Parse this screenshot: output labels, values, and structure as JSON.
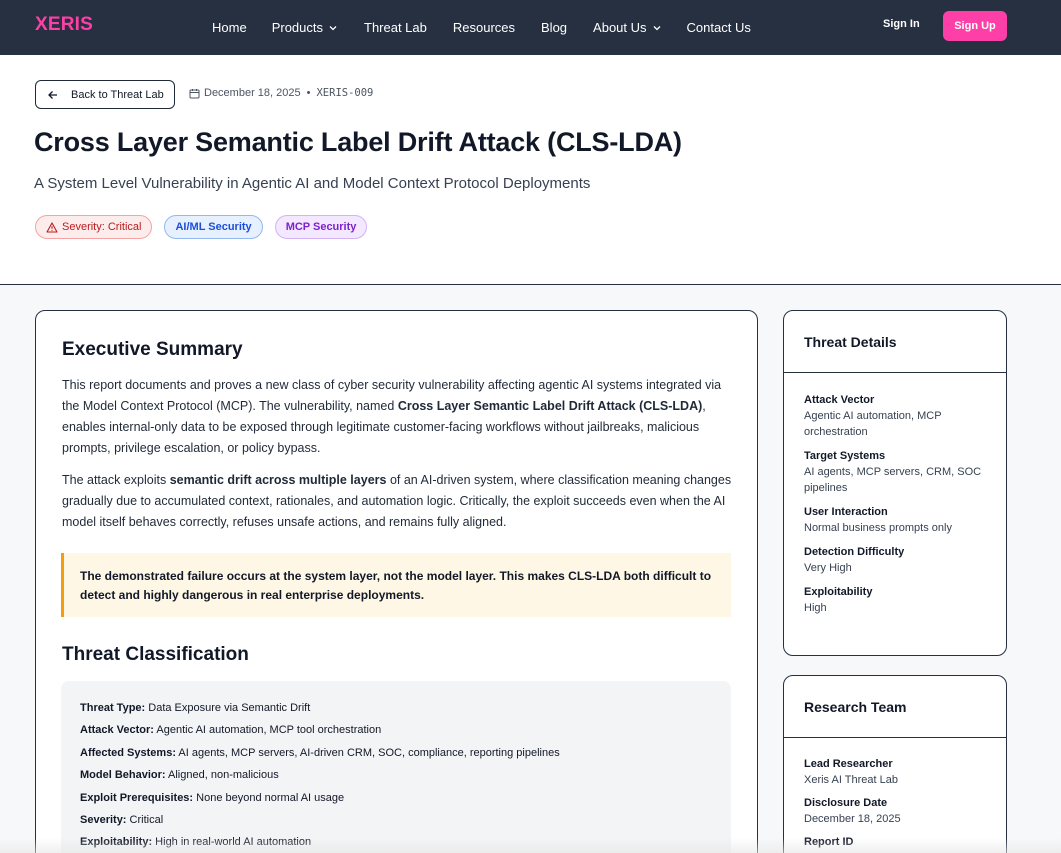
{
  "nav": {
    "logo": "XERIS",
    "links": [
      "Home",
      "Products",
      "Threat Lab",
      "Resources",
      "Blog",
      "About Us",
      "Contact Us"
    ],
    "sign_in": "Sign In",
    "sign_up": "Sign Up"
  },
  "header": {
    "back_label": "Back to Threat Lab",
    "date": "December 18, 2025",
    "separator": "•",
    "report_id": "XERIS-009",
    "title": "Cross Layer Semantic Label Drift Attack (CLS-LDA)",
    "subtitle": "A System Level Vulnerability in Agentic AI and Model Context Protocol Deployments",
    "tags": [
      "Severity: Critical",
      "AI/ML Security",
      "MCP Security"
    ]
  },
  "main": {
    "exec_title": "Executive Summary",
    "p1": {
      "a": "This report documents and proves a new class of cyber security vulnerability affecting agentic AI systems integrated via the Model Context Protocol (MCP). The vulnerability, named ",
      "b": "Cross Layer Semantic Label Drift Attack (CLS-LDA)",
      "c": ", enables internal-only data to be exposed through legitimate customer-facing workflows without jailbreaks, malicious prompts, privilege escalation, or policy bypass."
    },
    "p2": {
      "a": "The attack exploits ",
      "b": "semantic drift across multiple layers",
      "c": " of an AI-driven system, where classification meaning changes gradually due to accumulated context, rationales, and automation logic. Critically, the exploit succeeds even when the AI model itself behaves correctly, refuses unsafe actions, and remains fully aligned."
    },
    "callout": "The demonstrated failure occurs at the system layer, not the model layer. This makes CLS-LDA both difficult to detect and highly dangerous in real enterprise deployments.",
    "class_title": "Threat Classification",
    "classification": [
      {
        "k": "Threat Type:",
        "v": " Data Exposure via Semantic Drift"
      },
      {
        "k": "Attack Vector:",
        "v": " Agentic AI automation, MCP tool orchestration"
      },
      {
        "k": "Affected Systems:",
        "v": " AI agents, MCP servers, AI-driven CRM, SOC, compliance, reporting pipelines"
      },
      {
        "k": "Model Behavior:",
        "v": " Aligned, non-malicious"
      },
      {
        "k": "Exploit Prerequisites:",
        "v": " None beyond normal AI usage"
      },
      {
        "k": "Severity:",
        "v": " Critical"
      },
      {
        "k": "Exploitability:",
        "v": " High in real-world AI automation"
      }
    ]
  },
  "sidebar": {
    "threat_title": "Threat Details",
    "threat_items": [
      {
        "label": "Attack Vector",
        "value": "Agentic AI automation, MCP orchestration"
      },
      {
        "label": "Target Systems",
        "value": "AI agents, MCP servers, CRM, SOC pipelines"
      },
      {
        "label": "User Interaction",
        "value": "Normal business prompts only"
      },
      {
        "label": "Detection Difficulty",
        "value": "Very High"
      },
      {
        "label": "Exploitability",
        "value": "High"
      }
    ],
    "team_title": "Research Team",
    "team_items": [
      {
        "label": "Lead Researcher",
        "value": "Xeris AI Threat Lab"
      },
      {
        "label": "Disclosure Date",
        "value": "December 18, 2025"
      },
      {
        "label": "Report ID",
        "value": ""
      }
    ]
  }
}
